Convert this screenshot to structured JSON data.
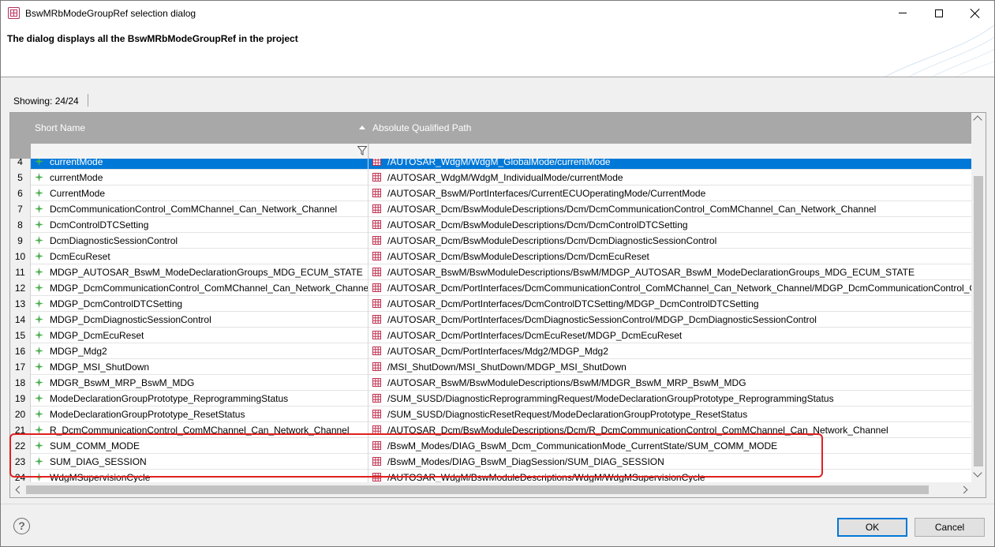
{
  "window": {
    "title": "BswMRbModeGroupRef selection dialog"
  },
  "header": {
    "message": "The dialog displays all the BswMRbModeGroupRef in the project"
  },
  "status": {
    "showing": "Showing: 24/24"
  },
  "table": {
    "columns": {
      "short_name": "Short Name",
      "path": "Absolute Qualified Path"
    },
    "sort_column": "Absolute Qualified Path",
    "selected_row": "4",
    "rows": [
      {
        "num": "4",
        "short": "currentMode",
        "path": "/AUTOSAR_WdgM/WdgM_GlobalMode/currentMode"
      },
      {
        "num": "5",
        "short": "currentMode",
        "path": "/AUTOSAR_WdgM/WdgM_IndividualMode/currentMode"
      },
      {
        "num": "6",
        "short": "CurrentMode",
        "path": "/AUTOSAR_BswM/PortInterfaces/CurrentECUOperatingMode/CurrentMode"
      },
      {
        "num": "7",
        "short": "DcmCommunicationControl_ComMChannel_Can_Network_Channel",
        "path": "/AUTOSAR_Dcm/BswModuleDescriptions/Dcm/DcmCommunicationControl_ComMChannel_Can_Network_Channel"
      },
      {
        "num": "8",
        "short": "DcmControlDTCSetting",
        "path": "/AUTOSAR_Dcm/BswModuleDescriptions/Dcm/DcmControlDTCSetting"
      },
      {
        "num": "9",
        "short": "DcmDiagnosticSessionControl",
        "path": "/AUTOSAR_Dcm/BswModuleDescriptions/Dcm/DcmDiagnosticSessionControl"
      },
      {
        "num": "10",
        "short": "DcmEcuReset",
        "path": "/AUTOSAR_Dcm/BswModuleDescriptions/Dcm/DcmEcuReset"
      },
      {
        "num": "11",
        "short": "MDGP_AUTOSAR_BswM_ModeDeclarationGroups_MDG_ECUM_STATE",
        "path": "/AUTOSAR_BswM/BswModuleDescriptions/BswM/MDGP_AUTOSAR_BswM_ModeDeclarationGroups_MDG_ECUM_STATE"
      },
      {
        "num": "12",
        "short": "MDGP_DcmCommunicationControl_ComMChannel_Can_Network_Channel",
        "path": "/AUTOSAR_Dcm/PortInterfaces/DcmCommunicationControl_ComMChannel_Can_Network_Channel/MDGP_DcmCommunicationControl_C"
      },
      {
        "num": "13",
        "short": "MDGP_DcmControlDTCSetting",
        "path": "/AUTOSAR_Dcm/PortInterfaces/DcmControlDTCSetting/MDGP_DcmControlDTCSetting"
      },
      {
        "num": "14",
        "short": "MDGP_DcmDiagnosticSessionControl",
        "path": "/AUTOSAR_Dcm/PortInterfaces/DcmDiagnosticSessionControl/MDGP_DcmDiagnosticSessionControl"
      },
      {
        "num": "15",
        "short": "MDGP_DcmEcuReset",
        "path": "/AUTOSAR_Dcm/PortInterfaces/DcmEcuReset/MDGP_DcmEcuReset"
      },
      {
        "num": "16",
        "short": "MDGP_Mdg2",
        "path": "/AUTOSAR_Dcm/PortInterfaces/Mdg2/MDGP_Mdg2"
      },
      {
        "num": "17",
        "short": "MDGP_MSI_ShutDown",
        "path": "/MSI_ShutDown/MSI_ShutDown/MDGP_MSI_ShutDown"
      },
      {
        "num": "18",
        "short": "MDGR_BswM_MRP_BswM_MDG",
        "path": "/AUTOSAR_BswM/BswModuleDescriptions/BswM/MDGR_BswM_MRP_BswM_MDG"
      },
      {
        "num": "19",
        "short": "ModeDeclarationGroupPrototype_ReprogrammingStatus",
        "path": "/SUM_SUSD/DiagnosticReprogrammingRequest/ModeDeclarationGroupPrototype_ReprogrammingStatus"
      },
      {
        "num": "20",
        "short": "ModeDeclarationGroupPrototype_ResetStatus",
        "path": "/SUM_SUSD/DiagnosticResetRequest/ModeDeclarationGroupPrototype_ResetStatus"
      },
      {
        "num": "21",
        "short": "R_DcmCommunicationControl_ComMChannel_Can_Network_Channel",
        "path": "/AUTOSAR_Dcm/BswModuleDescriptions/Dcm/R_DcmCommunicationControl_ComMChannel_Can_Network_Channel"
      },
      {
        "num": "22",
        "short": "SUM_COMM_MODE",
        "path": "/BswM_Modes/DIAG_BswM_Dcm_CommunicationMode_CurrentState/SUM_COMM_MODE"
      },
      {
        "num": "23",
        "short": "SUM_DIAG_SESSION",
        "path": "/BswM_Modes/DIAG_BswM_DiagSession/SUM_DIAG_SESSION"
      },
      {
        "num": "24",
        "short": "WdgMSupervisionCycle",
        "path": "/AUTOSAR_WdgM/BswModuleDescriptions/WdgM/WdgMSupervisionCycle"
      }
    ]
  },
  "buttons": {
    "help": "?",
    "ok": "OK",
    "cancel": "Cancel"
  },
  "colors": {
    "selection": "#0078d7",
    "header_bg": "#a8a8a8",
    "highlight_annotation": "#e02020",
    "mode_icon": "#4caf50",
    "package_icon": "#c03050"
  },
  "icons": {
    "app": "grid-icon",
    "row_short": "mode-group-icon",
    "row_path": "package-icon",
    "filter": "filter-icon"
  }
}
